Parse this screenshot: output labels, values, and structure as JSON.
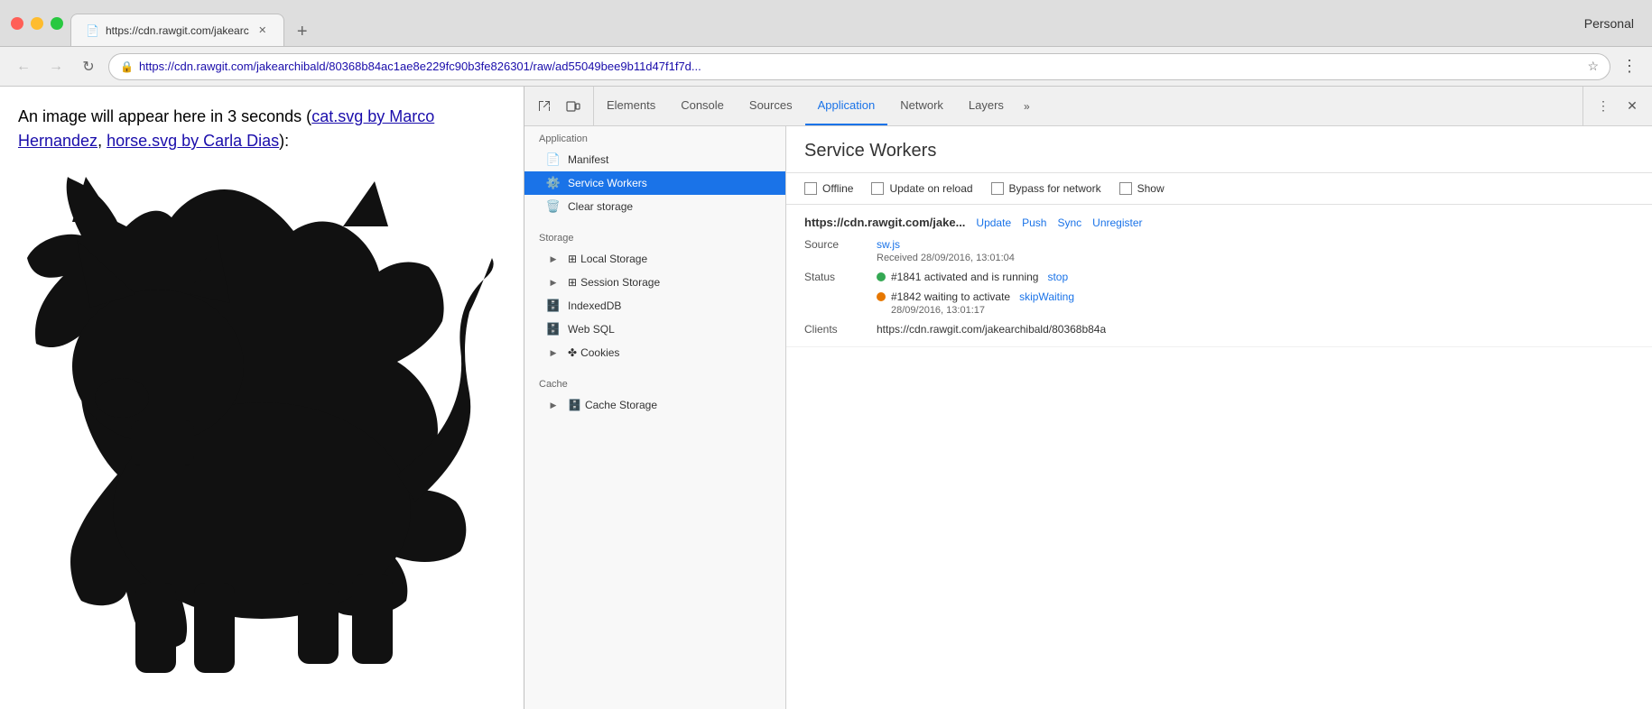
{
  "browser": {
    "profile": "Personal",
    "tab": {
      "url": "https://cdn.rawgit.com/jakearchibald/80368b84ac1ae8e229fc90b3fe826301/raw/ad55049bee9b11d47f1f7d...",
      "url_display": "https://cdn.rawgit.com/jakearchibald/80368b84ac1ae8e229fc90b3fe826301/raw/ad55049bee9b11d47f1f7d...",
      "url_full": "https://cdn.rawgit.com/jakearc",
      "favicon": "📄"
    }
  },
  "page": {
    "text_before": "An image will appear here in 3 seconds (",
    "link1_text": "cat.svg by Marco Hernandez",
    "link1_separator": ", ",
    "link2_text": "horse.svg by Carla Dias",
    "text_after": "):"
  },
  "devtools": {
    "tabs": [
      {
        "id": "elements",
        "label": "Elements"
      },
      {
        "id": "console",
        "label": "Console"
      },
      {
        "id": "sources",
        "label": "Sources"
      },
      {
        "id": "application",
        "label": "Application"
      },
      {
        "id": "network",
        "label": "Network"
      },
      {
        "id": "layers",
        "label": "Layers"
      }
    ],
    "active_tab": "application",
    "sidebar": {
      "sections": [
        {
          "id": "application",
          "label": "Application",
          "items": [
            {
              "id": "manifest",
              "label": "Manifest",
              "icon": "📄",
              "active": false
            },
            {
              "id": "service-workers",
              "label": "Service Workers",
              "icon": "⚙️",
              "active": true
            },
            {
              "id": "clear-storage",
              "label": "Clear storage",
              "icon": "🗑️",
              "active": false
            }
          ]
        },
        {
          "id": "storage",
          "label": "Storage",
          "items": [
            {
              "id": "local-storage",
              "label": "Local Storage",
              "icon": "▶",
              "has_arrow": true,
              "active": false
            },
            {
              "id": "session-storage",
              "label": "Session Storage",
              "icon": "▶",
              "has_arrow": true,
              "active": false
            },
            {
              "id": "indexeddb",
              "label": "IndexedDB",
              "icon": "🗄️",
              "active": false
            },
            {
              "id": "web-sql",
              "label": "Web SQL",
              "icon": "🗄️",
              "active": false
            },
            {
              "id": "cookies",
              "label": "Cookies",
              "icon": "▶",
              "has_arrow": true,
              "active": false
            }
          ]
        },
        {
          "id": "cache",
          "label": "Cache",
          "items": [
            {
              "id": "cache-storage",
              "label": "Cache Storage",
              "icon": "▶",
              "has_arrow": true,
              "active": false
            }
          ]
        }
      ]
    },
    "panel": {
      "title": "Service Workers",
      "options": [
        {
          "id": "offline",
          "label": "Offline",
          "checked": false
        },
        {
          "id": "update-on-reload",
          "label": "Update on reload",
          "checked": false
        },
        {
          "id": "bypass-for-network",
          "label": "Bypass for network",
          "checked": false
        },
        {
          "id": "show",
          "label": "Show",
          "checked": false
        }
      ],
      "service_worker": {
        "url": "https://cdn.rawgit.com/jake...",
        "actions": [
          "Update",
          "Push",
          "Sync",
          "Unregister"
        ],
        "source_label": "Source",
        "source_file": "sw.js",
        "received": "Received 28/09/2016, 13:01:04",
        "status_label": "Status",
        "status1": {
          "color": "green",
          "text": "#1841 activated and is running",
          "action": "stop"
        },
        "status2": {
          "color": "orange",
          "text": "#1842 waiting to activate",
          "action": "skipWaiting",
          "time": "28/09/2016, 13:01:17"
        },
        "clients_label": "Clients",
        "clients_url": "https://cdn.rawgit.com/jakearchibald/80368b84a"
      }
    }
  }
}
